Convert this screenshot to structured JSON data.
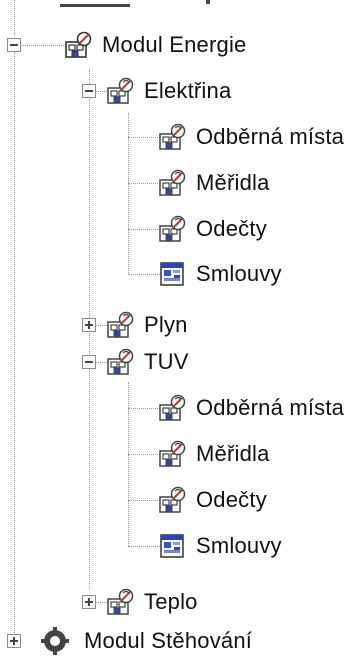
{
  "tree": {
    "top_partial": {
      "label": ""
    },
    "module": {
      "label": "Modul Energie",
      "expanded": true,
      "icon": "module-icon"
    },
    "groups": [
      {
        "label": "Elektřina",
        "expanded": true,
        "icon": "node-icon",
        "children": [
          {
            "label": "Odběrná místa",
            "icon": "node-icon"
          },
          {
            "label": "Měřidla",
            "icon": "node-icon"
          },
          {
            "label": "Odečty",
            "icon": "node-icon"
          },
          {
            "label": "Smlouvy",
            "icon": "contract-icon"
          }
        ]
      },
      {
        "label": "Plyn",
        "expanded": false,
        "icon": "node-icon",
        "children": []
      },
      {
        "label": "TUV",
        "expanded": true,
        "icon": "node-icon",
        "children": [
          {
            "label": "Odběrná místa",
            "icon": "node-icon"
          },
          {
            "label": "Měřidla",
            "icon": "node-icon"
          },
          {
            "label": "Odečty",
            "icon": "node-icon"
          },
          {
            "label": "Smlouvy",
            "icon": "contract-icon"
          }
        ]
      },
      {
        "label": "Teplo",
        "expanded": false,
        "icon": "node-icon",
        "children": []
      }
    ],
    "next_module": {
      "label": "Modul Stěhování",
      "icon": "gear-module-icon"
    }
  },
  "colors": {
    "tree_line": "#9a9a9a",
    "icon_blue": "#2b46b0",
    "icon_red": "#c0392b"
  }
}
